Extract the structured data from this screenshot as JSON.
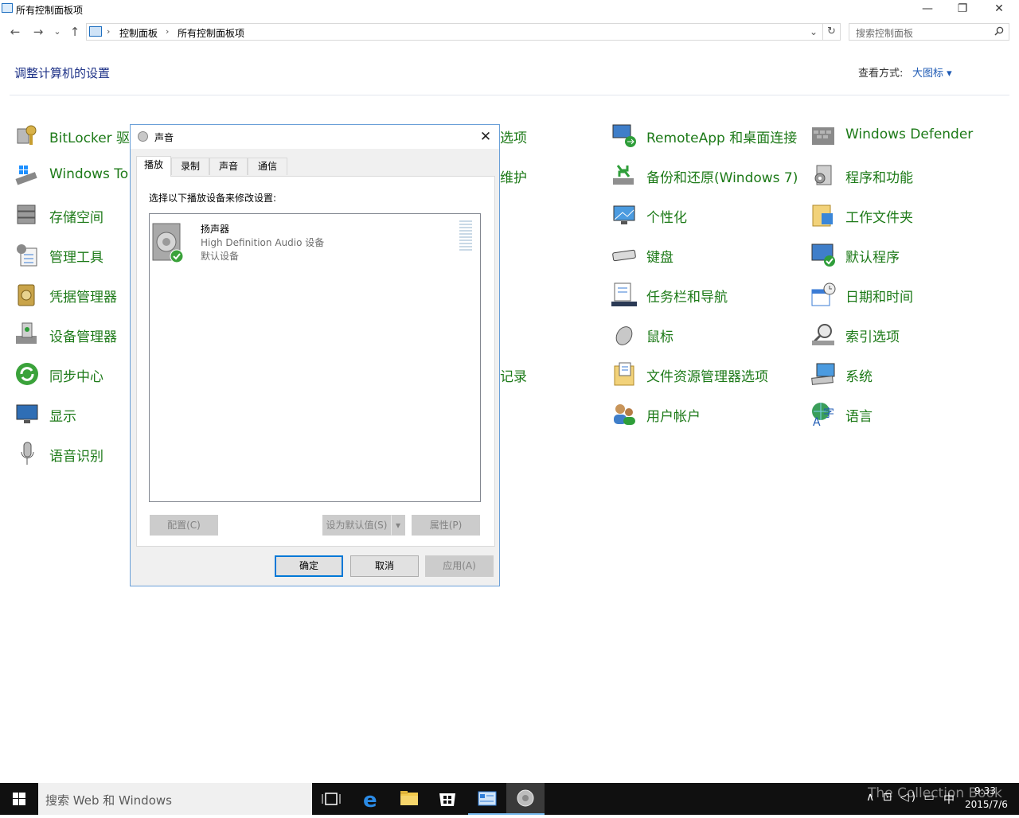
{
  "window": {
    "title": "所有控制面板项",
    "minimize_glyph": "—",
    "restore_glyph": "❐",
    "close_glyph": "✕"
  },
  "nav": {
    "back_glyph": "←",
    "forward_glyph": "→",
    "recent_glyph": "⌄",
    "up_glyph": "↑",
    "breadcrumbs": [
      "控制面板",
      "所有控制面板项"
    ],
    "breadcrumb_sep": "›",
    "dropdown_glyph": "⌄",
    "refresh_glyph": "↻"
  },
  "search": {
    "placeholder": "搜索控制面板",
    "icon": "search-icon"
  },
  "header": {
    "title": "调整计算机的设置",
    "view_label": "查看方式:",
    "view_value": "大图标 ▾"
  },
  "items": {
    "col1": [
      "BitLocker 驱动",
      "Windows To G",
      "存储空间",
      "管理工具",
      "凭据管理器",
      "设备管理器",
      "同步中心",
      "显示",
      "语音识别"
    ],
    "col3_partial": [
      "选项",
      "维护",
      "记录"
    ],
    "col4": [
      "RemoteApp 和桌面连接",
      "备份和还原(Windows 7)",
      "个性化",
      "键盘",
      "任务栏和导航",
      "鼠标",
      "文件资源管理器选项",
      "用户帐户"
    ],
    "col5": [
      "Windows Defender",
      "程序和功能",
      "工作文件夹",
      "默认程序",
      "日期和时间",
      "索引选项",
      "系统",
      "语言"
    ]
  },
  "dialog": {
    "title": "声音",
    "close_glyph": "✕",
    "tabs": [
      "播放",
      "录制",
      "声音",
      "通信"
    ],
    "active_tab": "播放",
    "instruction": "选择以下播放设备来修改设置:",
    "device": {
      "name": "扬声器",
      "description": "High Definition Audio 设备",
      "status": "默认设备"
    },
    "buttons": {
      "configure": "配置(C)",
      "set_default": "设为默认值(S)",
      "set_default_arrow": "▾",
      "properties": "属性(P)",
      "ok": "确定",
      "cancel": "取消",
      "apply": "应用(A)"
    }
  },
  "taskbar": {
    "search_placeholder": "搜索 Web 和 Windows",
    "time": "9:33",
    "date": "2015/7/6",
    "ime": "中",
    "watermark": "The Collection Book",
    "tray_glyphs": "∧ ⊡ ◁) ▭"
  },
  "colors": {
    "link_green": "#1d7a18",
    "title_blue": "#1e3287",
    "taskbar": "#101010",
    "accent": "#0078d7"
  }
}
